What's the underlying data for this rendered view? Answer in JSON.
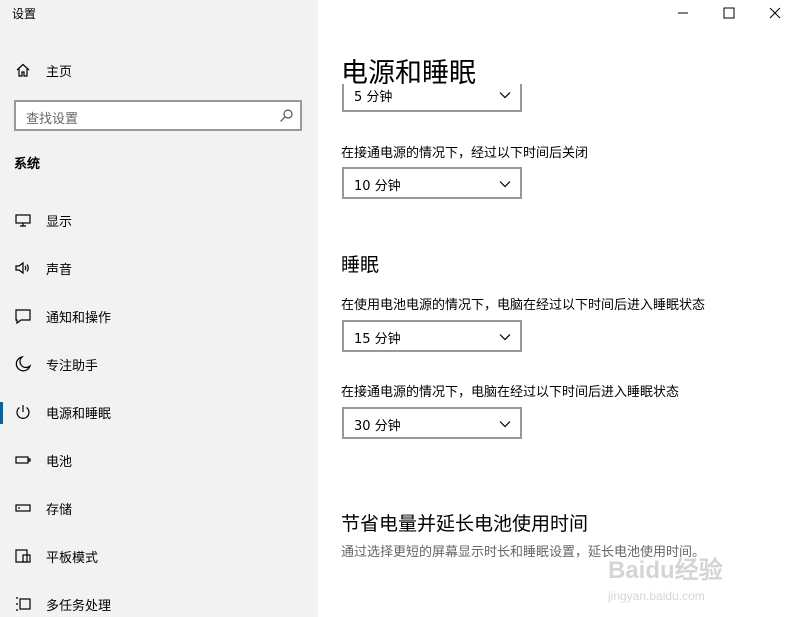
{
  "window": {
    "title": "设置"
  },
  "sidebar": {
    "home_label": "主页",
    "search_placeholder": "查找设置",
    "group_title": "系统",
    "items": [
      {
        "label": "显示",
        "icon": "monitor-icon"
      },
      {
        "label": "声音",
        "icon": "speaker-icon"
      },
      {
        "label": "通知和操作",
        "icon": "notification-icon"
      },
      {
        "label": "专注助手",
        "icon": "moon-icon"
      },
      {
        "label": "电源和睡眠",
        "icon": "power-icon",
        "active": true
      },
      {
        "label": "电池",
        "icon": "battery-icon"
      },
      {
        "label": "存储",
        "icon": "storage-icon"
      },
      {
        "label": "平板模式",
        "icon": "tablet-icon"
      },
      {
        "label": "多任务处理",
        "icon": "multitask-icon"
      }
    ]
  },
  "main": {
    "page_title": "电源和睡眠",
    "screen": {
      "top_dropdown_value": "5 分钟",
      "plugged_label": "在接通电源的情况下，经过以下时间后关闭",
      "plugged_value": "10 分钟"
    },
    "sleep": {
      "title": "睡眠",
      "battery_label": "在使用电池电源的情况下，电脑在经过以下时间后进入睡眠状态",
      "battery_value": "15 分钟",
      "plugged_label": "在接通电源的情况下，电脑在经过以下时间后进入睡眠状态",
      "plugged_value": "30 分钟"
    },
    "save": {
      "title": "节省电量并延长电池使用时间",
      "description": "通过选择更短的屏幕显示时长和睡眠设置，延长电池使用时间。"
    }
  },
  "watermark": {
    "text": "Baidu经验",
    "url_text": "jingyan.baidu.com"
  },
  "colors": {
    "sidebar_bg": "#f2f2f2",
    "accent": "#0063b1"
  }
}
